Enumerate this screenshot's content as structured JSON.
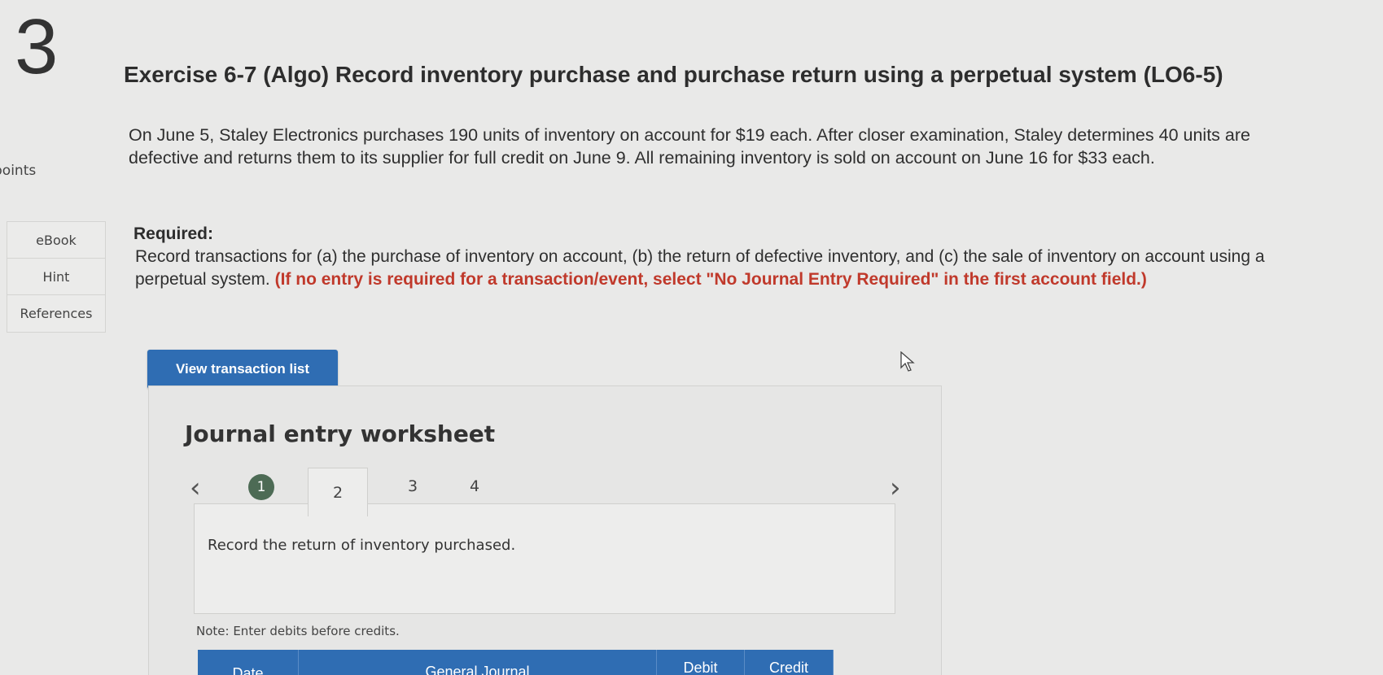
{
  "question": {
    "number": "3",
    "points_label": "points"
  },
  "side_tools": [
    {
      "label": "eBook"
    },
    {
      "label": "Hint"
    },
    {
      "label": "References"
    }
  ],
  "exercise": {
    "title": "Exercise 6-7 (Algo) Record inventory purchase and purchase return using a perpetual system (LO6-5)",
    "problem_text": "On June 5, Staley Electronics purchases 190 units of inventory on account for $19 each. After closer examination, Staley determines 40 units are defective and returns them to its supplier for full credit on June 9. All remaining inventory is sold on account on June 16 for $33 each.",
    "required_heading": "Required:",
    "required_text": "Record transactions for (a) the purchase of inventory on account, (b) the return of defective inventory, and (c) the sale of inventory on account using a perpetual system.",
    "required_note": "(If no entry is required for a transaction/event, select \"No Journal Entry Required\" in the first account field.)"
  },
  "buttons": {
    "view_transaction_list": "View transaction list"
  },
  "worksheet": {
    "title": "Journal entry worksheet",
    "steps": [
      "1",
      "2",
      "3",
      "4"
    ],
    "completed_step": "1",
    "active_step": "2",
    "instruction": "Record the return of inventory purchased.",
    "note": "Note: Enter debits before credits.",
    "columns": [
      "Date",
      "General Journal",
      "Debit",
      "Credit"
    ]
  },
  "colors": {
    "accent_blue": "#2f6db3",
    "completed_green": "#4d6b55",
    "note_red": "#c0392b"
  }
}
